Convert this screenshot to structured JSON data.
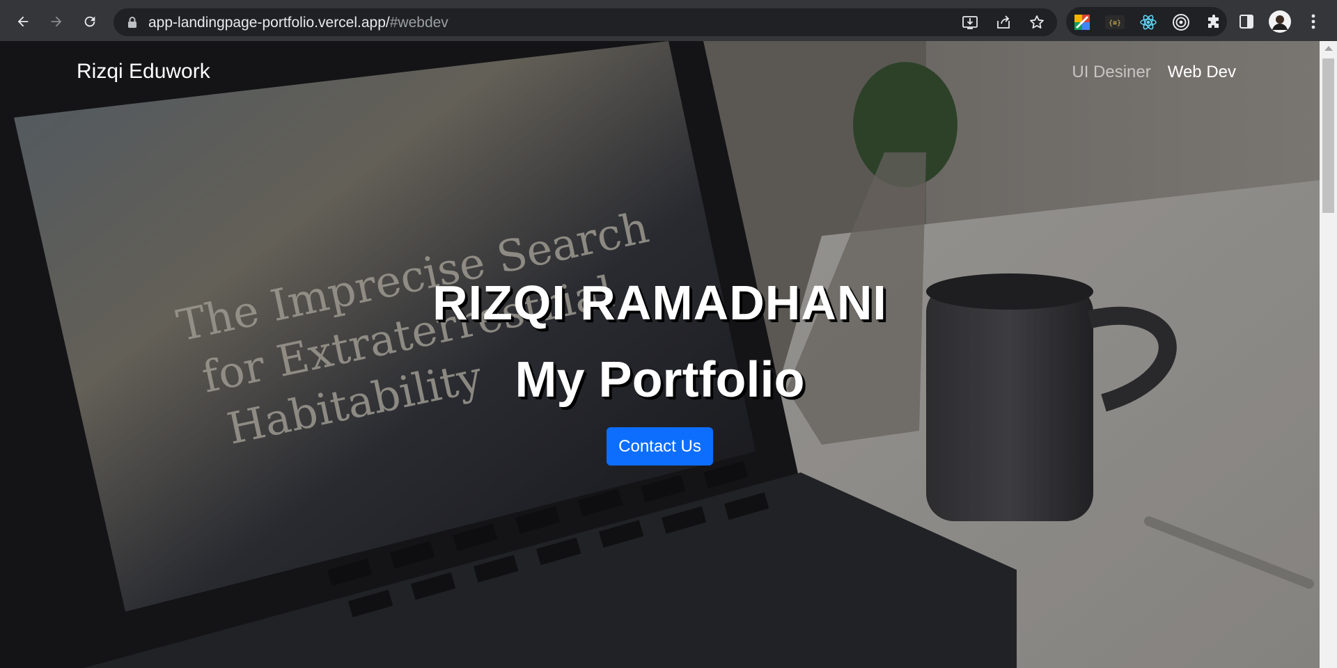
{
  "browser": {
    "url_host": "app-landingpage-portfolio.vercel.app/",
    "url_hash": "#webdev",
    "icons": {
      "back": "arrow-left-icon",
      "forward": "arrow-right-icon",
      "reload": "reload-icon",
      "lock": "lock-icon",
      "install": "install-app-icon",
      "share": "share-icon",
      "bookmark": "star-icon",
      "extensions": [
        "colorzilla-icon",
        "json-viewer-icon",
        "react-devtools-icon",
        "target-icon",
        "puzzle-icon"
      ],
      "side_panel": "side-panel-icon",
      "profile": "avatar",
      "menu": "kebab-menu-icon"
    }
  },
  "page": {
    "brand": "Rizqi Eduwork",
    "nav": [
      {
        "label": "UI Desiner",
        "active": false
      },
      {
        "label": "Web Dev",
        "active": true
      }
    ],
    "hero": {
      "name": "RIZQI RAMADHANI",
      "subtitle": "My Portfolio",
      "button": "Contact Us"
    },
    "background_text": [
      "The Imprecise Search",
      "for Extraterrestrial",
      "Habitability"
    ],
    "colors": {
      "primary_button": "#0d6efd",
      "chrome_bg": "#35363a",
      "urlbar_bg": "#202124"
    }
  }
}
